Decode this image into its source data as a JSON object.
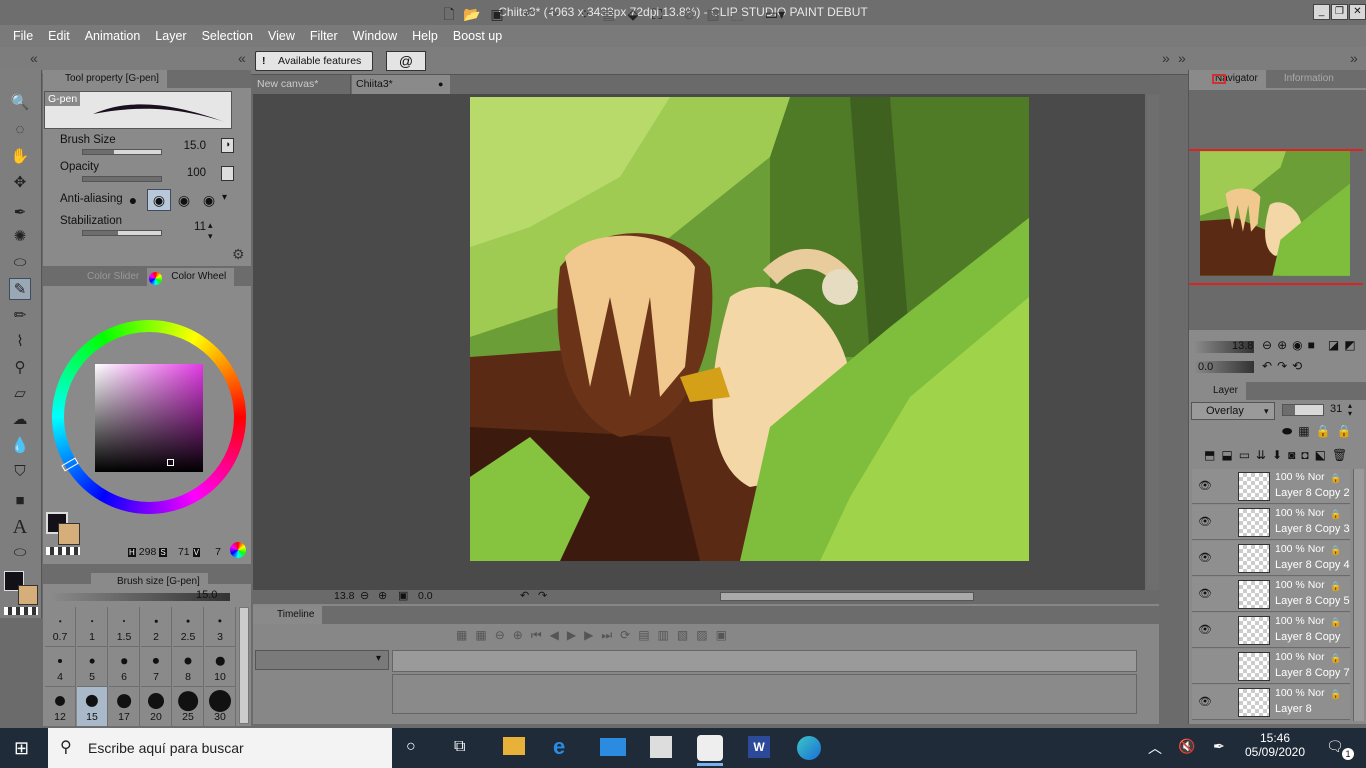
{
  "window": {
    "title": "Chiita3* (4063 x 3438px 72dpi 13.8%)  - CLIP STUDIO PAINT DEBUT"
  },
  "menu": [
    "File",
    "Edit",
    "Animation",
    "Layer",
    "Selection",
    "View",
    "Filter",
    "Window",
    "Help",
    "Boost up"
  ],
  "toolbar": {
    "available_features": "Available features"
  },
  "tool_property": {
    "tab": "Tool property [G-pen]",
    "brush_name": "G-pen",
    "brush_size_label": "Brush Size",
    "brush_size_value": "15.0",
    "brush_size_fill": 0.4,
    "opacity_label": "Opacity",
    "opacity_value": "100",
    "opacity_fill": 1.0,
    "antialias_label": "Anti-aliasing",
    "stabilization_label": "Stabilization",
    "stabilization_value": "11",
    "stabilization_fill": 0.45
  },
  "color": {
    "tab_slider": "Color Slider",
    "tab_wheel": "Color Wheel",
    "h_label": "H",
    "h_value": "298",
    "s_label": "S",
    "s_value": "71",
    "v_label": "V",
    "v_value": "7",
    "main_color": "#141018",
    "sub_color": "#d6ae7a"
  },
  "brush_size_panel": {
    "tab": "Brush size [G-pen]",
    "value": "15.0",
    "sizes": [
      "0.7",
      "1",
      "1.5",
      "2",
      "2.5",
      "3",
      "4",
      "5",
      "6",
      "7",
      "8",
      "10",
      "12",
      "15",
      "17",
      "20",
      "25",
      "30"
    ],
    "selected": "15"
  },
  "canvas": {
    "tabs": [
      "New canvas*",
      "Chiita3*"
    ],
    "zoom": "13.8",
    "angle": "0.0"
  },
  "timeline": {
    "title": "Timeline"
  },
  "navigator": {
    "tab_navigator": "Navigator",
    "tab_information": "Information",
    "zoom": "13.8",
    "angle": "0.0"
  },
  "layer_panel": {
    "tab": "Layer",
    "blend_mode": "Overlay",
    "opacity": "31",
    "layers": [
      {
        "pct": "100 % Nor",
        "name": "Layer 8 Copy 2",
        "visible": true
      },
      {
        "pct": "100 % Nor",
        "name": "Layer 8 Copy 3",
        "visible": true
      },
      {
        "pct": "100 % Nor",
        "name": "Layer 8 Copy 4",
        "visible": true
      },
      {
        "pct": "100 % Nor",
        "name": "Layer 8 Copy 5",
        "visible": true
      },
      {
        "pct": "100 % Nor",
        "name": "Layer 8 Copy",
        "visible": true
      },
      {
        "pct": "100 % Nor",
        "name": "Layer 8 Copy 7",
        "visible": false
      },
      {
        "pct": "100 % Nor",
        "name": "Layer 8",
        "visible": true
      }
    ]
  },
  "taskbar": {
    "search_placeholder": "Escribe aquí para buscar",
    "time": "15:46",
    "date": "05/09/2020",
    "notification_count": "1"
  }
}
